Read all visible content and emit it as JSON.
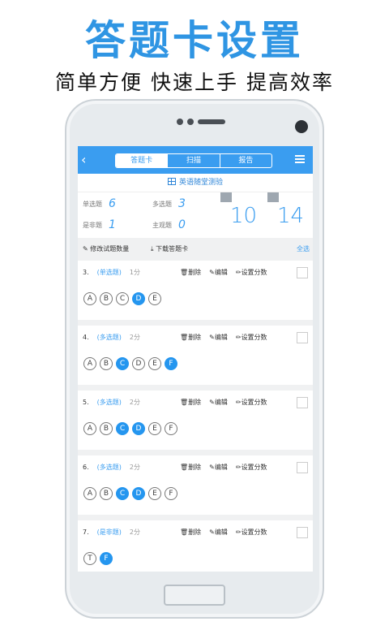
{
  "promo": {
    "headline": "答题卡设置",
    "subline": "简单方便 快速上手 提高效率"
  },
  "app": {
    "back_icon": "‹",
    "tabs": [
      {
        "label": "答题卡",
        "active": true
      },
      {
        "label": "扫描",
        "active": false
      },
      {
        "label": "报告",
        "active": false
      }
    ],
    "quiz_title": "英语随堂测验",
    "stats": {
      "single_label": "单选题",
      "single_count": "6",
      "multi_label": "多选题",
      "multi_count": "3",
      "tf_label": "是非题",
      "tf_count": "1",
      "subjective_label": "主观题",
      "subjective_count": "0",
      "total_a": "10",
      "total_b": "14"
    },
    "actions": {
      "edit_count": "修改试题数量",
      "download": "下载答题卡",
      "select_all": "全选"
    },
    "questions": [
      {
        "num": "3.",
        "type": "(单选题)",
        "score": "1分",
        "options": [
          "A",
          "B",
          "C",
          "D",
          "E"
        ],
        "selected": [
          "D"
        ]
      },
      {
        "num": "4.",
        "type": "(多选题)",
        "score": "2分",
        "options": [
          "A",
          "B",
          "C",
          "D",
          "E",
          "F"
        ],
        "selected": [
          "C",
          "F"
        ]
      },
      {
        "num": "5.",
        "type": "(多选题)",
        "score": "2分",
        "options": [
          "A",
          "B",
          "C",
          "D",
          "E",
          "F"
        ],
        "selected": [
          "C",
          "D"
        ]
      },
      {
        "num": "6.",
        "type": "(多选题)",
        "score": "2分",
        "options": [
          "A",
          "B",
          "C",
          "D",
          "E",
          "F"
        ],
        "selected": [
          "C",
          "D"
        ]
      },
      {
        "num": "7.",
        "type": "(是非题)",
        "score": "2分",
        "options": [
          "T",
          "F"
        ],
        "selected": [
          "F"
        ]
      }
    ],
    "question_ops": {
      "delete": "删除",
      "edit": "编辑",
      "set_score": "设置分数"
    }
  }
}
